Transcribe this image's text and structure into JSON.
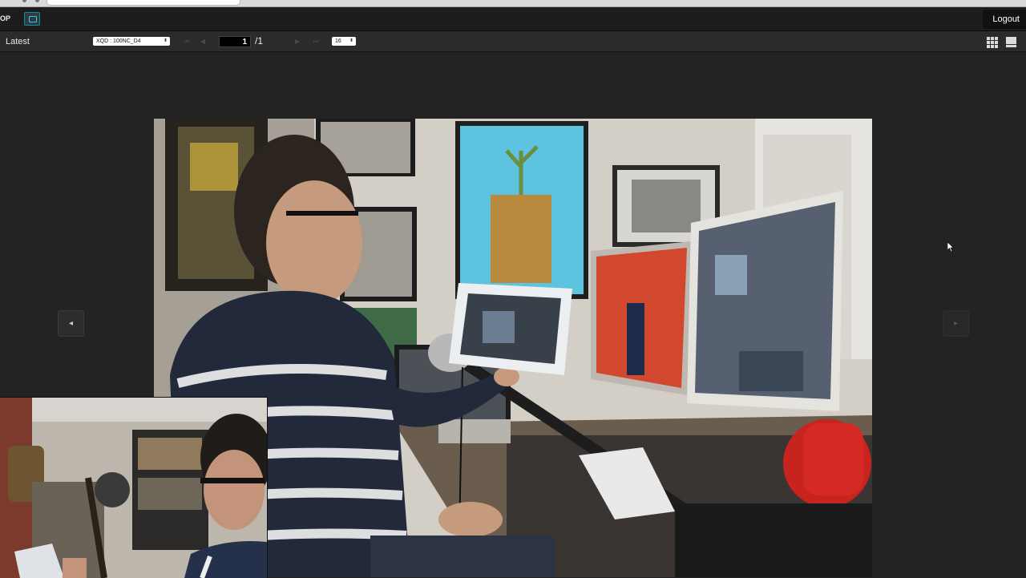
{
  "topbar": {
    "app_label": "OP",
    "logout_label": "Logout"
  },
  "toolbar": {
    "latest_label": "Latest",
    "folder_select": "XQD : 100NC_D4",
    "page_current": "1",
    "page_total": "/1",
    "thumb_size": "16"
  },
  "viewer": {
    "prev_icon": "◂",
    "next_icon": "▸"
  },
  "icons": {
    "first": "first-page-icon",
    "prev": "prev-page-icon",
    "next": "next-page-icon",
    "last": "last-page-icon",
    "grid": "grid-view-icon",
    "single": "single-view-icon"
  },
  "colors": {
    "accent": "#39c3e8",
    "background": "#232323"
  }
}
